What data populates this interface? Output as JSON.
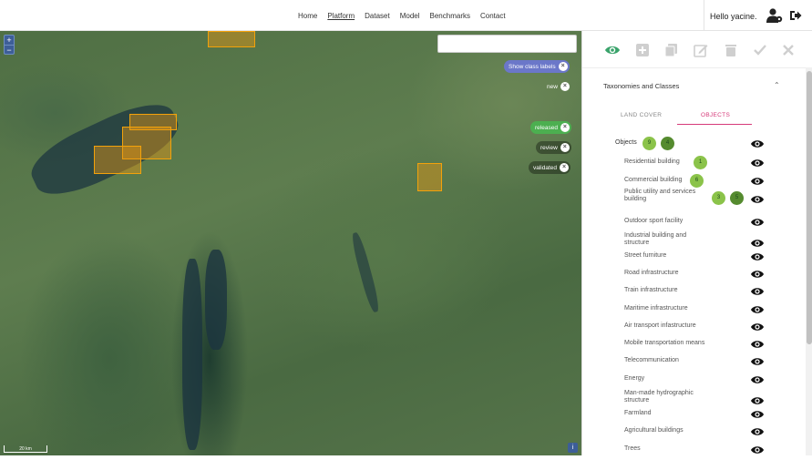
{
  "nav": {
    "links": [
      "Home",
      "Platform",
      "Dataset",
      "Model",
      "Benchmarks",
      "Contact"
    ],
    "active": "Platform"
  },
  "user": {
    "greeting": "Hello yacine."
  },
  "map": {
    "search_value": "",
    "zoom_in": "+",
    "zoom_out": "−",
    "scale_label": "20 km",
    "info_label": "i",
    "filters": [
      {
        "label": "Show class labels",
        "color": "#6b77c9"
      },
      {
        "label": "new",
        "color": "transparent"
      },
      {
        "label": "released",
        "color": "#4caf50"
      },
      {
        "label": "review",
        "color": "transparent"
      },
      {
        "label": "validated",
        "color": "transparent"
      }
    ]
  },
  "panel": {
    "section_title": "Taxonomies and Classes",
    "tabs": [
      "LAND COVER",
      "OBJECTS"
    ],
    "active_tab": "OBJECTS",
    "root": {
      "label": "Objects",
      "badges": [
        "9",
        "4"
      ]
    },
    "classes": [
      {
        "label": "Residential building",
        "badges": [
          "1"
        ]
      },
      {
        "label": "Commercial building",
        "badges": [
          "6"
        ]
      },
      {
        "label": "Public utility and services building",
        "badges": [
          "3",
          "5"
        ]
      },
      {
        "label": "Outdoor sport facility",
        "badges": []
      },
      {
        "label": "Industrial building and structure",
        "badges": []
      },
      {
        "label": "Street furniture",
        "badges": []
      },
      {
        "label": "Road infrastructure",
        "badges": []
      },
      {
        "label": "Train infrastructure",
        "badges": []
      },
      {
        "label": "Maritime infrastructure",
        "badges": []
      },
      {
        "label": "Air transport infastructure",
        "badges": []
      },
      {
        "label": "Mobile transportation means",
        "badges": []
      },
      {
        "label": "Telecommunication",
        "badges": []
      },
      {
        "label": "Energy",
        "badges": []
      },
      {
        "label": "Man-made hydrographic structure",
        "badges": []
      },
      {
        "label": "Farmland",
        "badges": []
      },
      {
        "label": "Agricultural buildings",
        "badges": []
      },
      {
        "label": "Trees",
        "badges": []
      }
    ]
  },
  "colors": {
    "accent": "#d63a7a",
    "badge_green_light": "#8bc34a",
    "badge_green_dark": "#558b2f",
    "tool_active": "#3aa36b",
    "tool_disabled": "#cfcfcf"
  }
}
